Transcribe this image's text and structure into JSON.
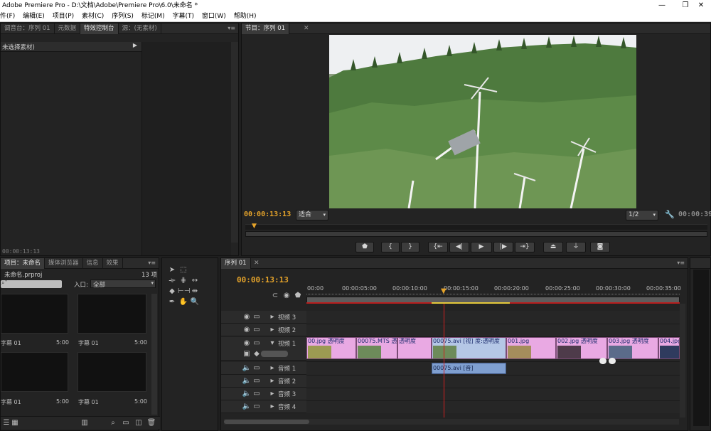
{
  "window": {
    "title": "Adobe Premiere Pro - D:\\文档\\Adobe\\Premiere Pro\\6.0\\未命名 *",
    "minimize_icon": "minimize-icon",
    "restore_icon": "restore-icon",
    "close_icon": "close-icon"
  },
  "menu": [
    "件(F)",
    "编辑(E)",
    "项目(P)",
    "素材(C)",
    "序列(S)",
    "标记(M)",
    "字幕(T)",
    "窗口(W)",
    "帮助(H)"
  ],
  "source_panel": {
    "tabs": [
      "调音台：序列 01",
      "元数据",
      "特效控制台",
      "源：(无素材)"
    ],
    "active_tab": 2,
    "no_clip_label": "未选择素材)",
    "timecode": "00:00:13:13"
  },
  "program_panel": {
    "tab": "节目：序列 01",
    "timecode_left": "00:00:13:13",
    "fit_select": "适合",
    "quality_select": "1/2",
    "timecode_right": "00:00:39:",
    "controls": [
      "marker-icon",
      "in-point-icon",
      "out-point-icon",
      "goto-in-icon",
      "step-back-icon",
      "play-icon",
      "step-forward-icon",
      "goto-out-icon",
      "lift-icon",
      "extract-icon",
      "export-frame-icon"
    ]
  },
  "project_panel": {
    "tabs": [
      "项目：未命名",
      "媒体浏览器",
      "信息",
      "效果"
    ],
    "project_file": "未命名.prproj",
    "item_count": "13 项",
    "in_label": "入口:",
    "in_value": "全部",
    "items": [
      {
        "name": "字幕 01",
        "duration": "5:00"
      },
      {
        "name": "字幕 01",
        "duration": "5:00"
      },
      {
        "name": "字幕 01",
        "duration": "5:00"
      },
      {
        "name": "字幕 01",
        "duration": "5:00"
      }
    ]
  },
  "tools": [
    "selection-icon",
    "track-select-icon",
    "ripple-edit-icon",
    "rolling-edit-icon",
    "rate-stretch-icon",
    "razor-icon",
    "slip-icon",
    "slide-icon",
    "pen-icon",
    "hand-icon",
    "zoom-icon"
  ],
  "timeline": {
    "tab": "序列 01",
    "timecode": "00:00:13:13",
    "ruler": [
      "00:00",
      "00:00:05:00",
      "00:00:10:00",
      "00:00:15:00",
      "00:00:20:00",
      "00:00:25:00",
      "00:00:30:00",
      "00:00:35:00"
    ],
    "tracks_video": [
      "视频 3",
      "视频 2",
      "视频 1"
    ],
    "tracks_audio": [
      "音频 1",
      "音频 2",
      "音频 3",
      "音频 4"
    ],
    "video_clips": [
      {
        "label": "00.jpg 透明度"
      },
      {
        "label": "00075.MTS 透明度"
      },
      {
        "label": "透明度"
      },
      {
        "label": "00075.avi [视] 度:透明度"
      },
      {
        "label": "001.jpg"
      },
      {
        "label": "002.jpg 透明度"
      },
      {
        "label": "003.jpg 透明度"
      },
      {
        "label": "004.jpg"
      }
    ],
    "audio_clip": "00075.avi [音]"
  },
  "colors": {
    "accent_timecode": "#e5a32a",
    "video_clip": "#e9a9e3",
    "audio_clip": "#7f9fd0",
    "playhead": "#d32020"
  }
}
